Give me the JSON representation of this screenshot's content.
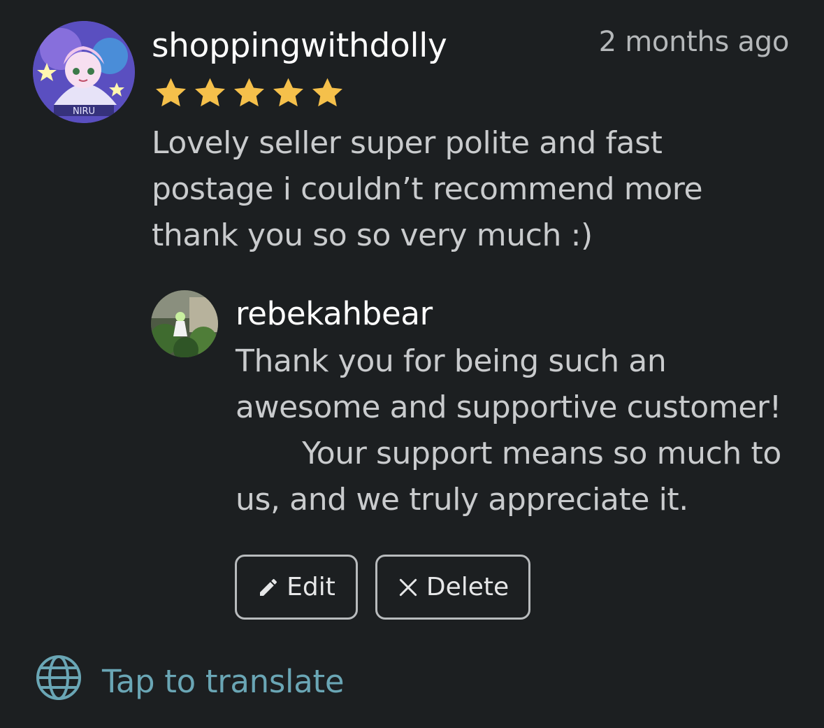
{
  "review": {
    "reviewer_name": "shoppingwithdolly",
    "date": "2 months ago",
    "rating": 5,
    "rating_max": 5,
    "star_color": "#f5c04b",
    "text": "Lovely seller super polite and fast\npostage i couldn’t recommend more\nthank you so so very much :)"
  },
  "reply": {
    "author_name": "rebekahbear",
    "text": "Thank you for being such an\nawesome and supportive customer!\n       Your support means so much to\nus, and we truly appreciate it."
  },
  "actions": {
    "edit_label": "Edit",
    "delete_label": "Delete"
  },
  "translate": {
    "label": "Tap to translate",
    "color": "#6aa6b5"
  }
}
